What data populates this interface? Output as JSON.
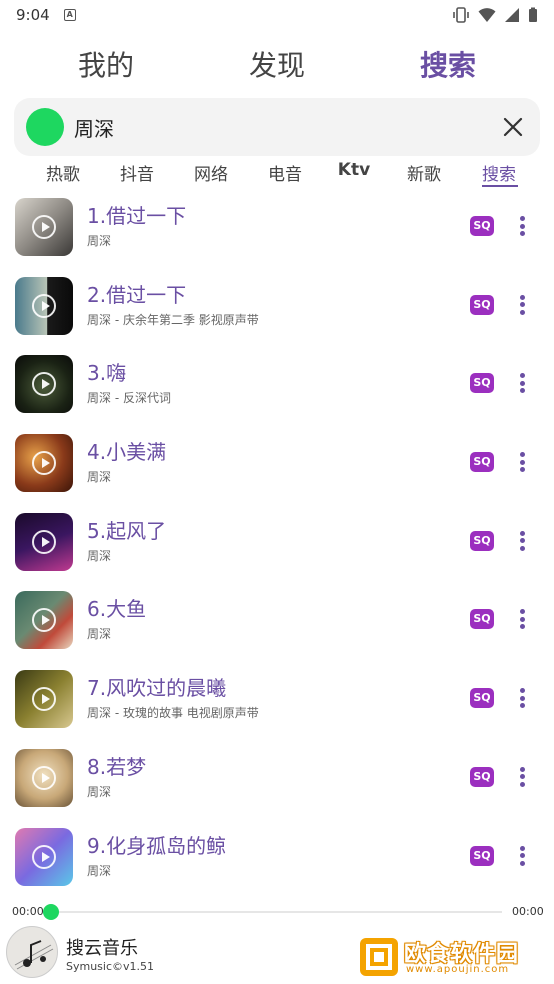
{
  "status_bar": {
    "time": "9:04",
    "a_badge": "A"
  },
  "top_tabs": [
    "我的",
    "发现",
    "搜索"
  ],
  "search": {
    "query": "周深"
  },
  "categories": [
    "热歌",
    "抖音",
    "网络",
    "电音",
    "Ktv",
    "新歌",
    "搜索"
  ],
  "songs": [
    {
      "title": "1.借过一下",
      "subtitle": "周深",
      "badge": "SQ"
    },
    {
      "title": "2.借过一下",
      "subtitle": "周深 - 庆余年第二季 影视原声带",
      "badge": "SQ"
    },
    {
      "title": "3.嗨",
      "subtitle": "周深 - 反深代词",
      "badge": "SQ"
    },
    {
      "title": "4.小美满",
      "subtitle": "周深",
      "badge": "SQ"
    },
    {
      "title": "5.起风了",
      "subtitle": "周深",
      "badge": "SQ"
    },
    {
      "title": "6.大鱼",
      "subtitle": "周深",
      "badge": "SQ"
    },
    {
      "title": "7.风吹过的晨曦",
      "subtitle": "周深 - 玫瑰的故事 电视剧原声带",
      "badge": "SQ"
    },
    {
      "title": "8.若梦",
      "subtitle": "周深",
      "badge": "SQ"
    },
    {
      "title": "9.化身孤岛的鲸",
      "subtitle": "周深",
      "badge": "SQ"
    }
  ],
  "player": {
    "elapsed": "00:00",
    "duration": "00:00",
    "progress": 0,
    "title": "搜云音乐",
    "version": "Symusic©v1.51"
  },
  "watermark": {
    "text": "欧食软件园",
    "url": "www.apoujin.com"
  },
  "colors": {
    "accent": "#6a4fa3",
    "green": "#1ed760",
    "sq_badge": "#9b2fbf"
  }
}
